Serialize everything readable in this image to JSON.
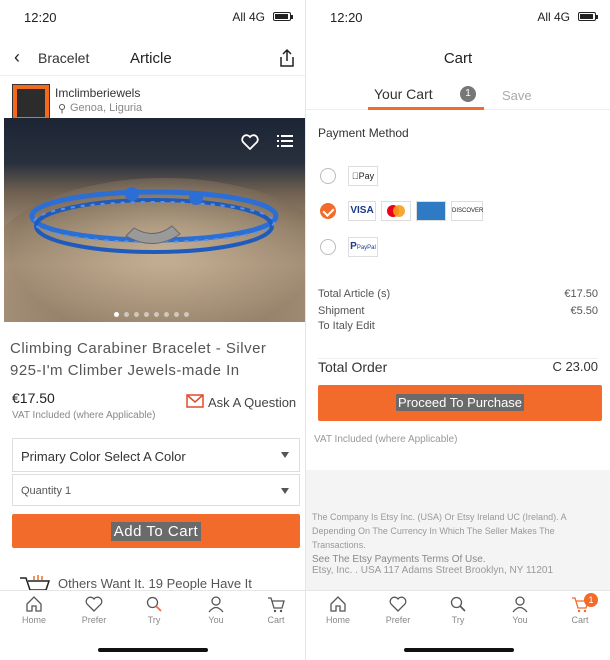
{
  "status": {
    "time": "12:20",
    "network": "All 4G"
  },
  "left": {
    "nav": {
      "back_label": "Bracelet",
      "title": "Article"
    },
    "shop": {
      "name": "Imclimberiewels",
      "location": "Genoa, Liguria"
    },
    "product": {
      "title": "Climbing Carabiner Bracelet - Silver 925-I'm Climber Jewels-made In",
      "price": "€17.50",
      "vat": "VAT Included (where Applicable)",
      "ask_question": "Ask A Question"
    },
    "color_select": "Primary Color Select A Color",
    "quantity_select": "Quantity 1",
    "add_to_cart": "Add To Cart",
    "others_want": "Others Want It. 19 People Have It"
  },
  "right": {
    "title": "Cart",
    "tabs": {
      "your_cart": "Your Cart",
      "count": "1",
      "save": "Save"
    },
    "payment_title": "Payment Method",
    "payment_methods": {
      "applepay": "Pay",
      "visa": "VISA",
      "discover": "DISCOVER",
      "paypal": "PayPal"
    },
    "summary": {
      "total_article_label": "Total Article (s)",
      "total_article_amount": "€17.50",
      "shipment_label": "Shipment",
      "shipment_amount": "€5.50",
      "shipment_dest": "To Italy Edit"
    },
    "total_order_label": "Total Order",
    "total_order_amount": "C 23.00",
    "proceed": "Proceed To Purchase",
    "vat": "VAT Included (where Applicable)",
    "legal": {
      "text1": "The Company Is Etsy Inc. (USA) Or Etsy Ireland UC (Ireland). A Depending On The Currency In Which The Seller Makes The Transactions.",
      "link": "See The Etsy Payments Terms Of Use.",
      "address": "Etsy, Inc. . USA 117 Adams Street Brooklyn, NY 11201"
    }
  },
  "tabs": {
    "home": "Home",
    "favorites": "Prefer",
    "search": "Try",
    "you": "You",
    "cart": "Cart",
    "cart_badge": "1"
  },
  "colors": {
    "accent": "#f26b2a"
  }
}
